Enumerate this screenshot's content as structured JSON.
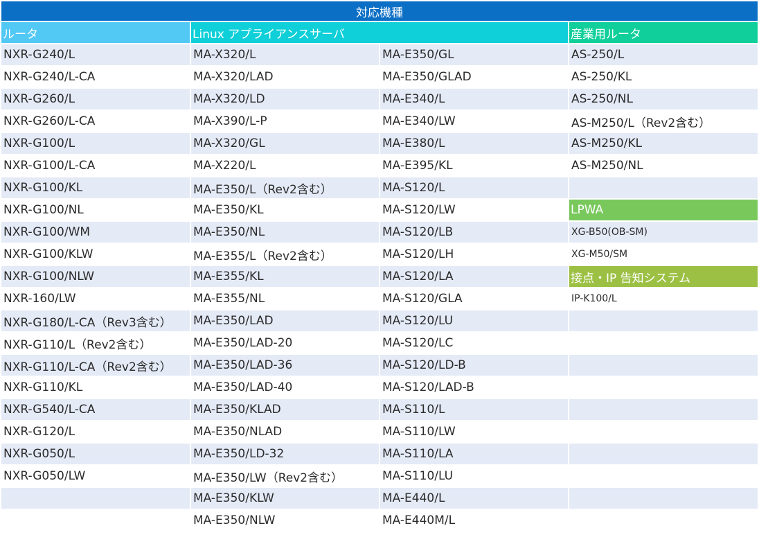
{
  "title": "対応機種",
  "headers": {
    "router": "ルータ",
    "linux": "Linux アプライアンスサーバ",
    "industrial": "産業用ルータ",
    "lpwa": "LPWA",
    "alarm": "接点・IP 告知システム"
  },
  "colors": {
    "title_bg": "#0c6fc6",
    "router_header": "#52c8f5",
    "linux_header": "#0fcfd8",
    "industrial_header": "#10cf9a",
    "lpwa_header": "#78c85c",
    "alarm_header": "#9cc043",
    "row_band": "#e4eaf6"
  },
  "router": [
    "NXR-G240/L",
    "NXR-G240/L-CA",
    "NXR-G260/L",
    "NXR-G260/L-CA",
    "NXR-G100/L",
    "NXR-G100/L-CA",
    "NXR-G100/KL",
    "NXR-G100/NL",
    "NXR-G100/WM",
    "NXR-G100/KLW",
    "NXR-G100/NLW",
    "NXR-160/LW",
    "NXR-G180/L-CA（Rev3含む）",
    "NXR-G110/L（Rev2含む）",
    "NXR-G110/L-CA（Rev2含む）",
    "NXR-G110/KL",
    "NXR-G540/L-CA",
    "NXR-G120/L",
    "NXR-G050/L",
    "NXR-G050/LW",
    "",
    ""
  ],
  "linux1": [
    "MA-X320/L",
    "MA-X320/LAD",
    "MA-X320/LD",
    "MA-X390/L-P",
    "MA-X320/GL",
    "MA-X220/L",
    "MA-E350/L（Rev2含む）",
    "MA-E350/KL",
    "MA-E350/NL",
    "MA-E355/L（Rev2含む）",
    "MA-E355/KL",
    "MA-E355/NL",
    "MA-E350/LAD",
    "MA-E350/LAD-20",
    "MA-E350/LAD-36",
    "MA-E350/LAD-40",
    "MA-E350/KLAD",
    "MA-E350/NLAD",
    "MA-E350/LD-32",
    "MA-E350/LW（Rev2含む）",
    "MA-E350/KLW",
    "MA-E350/NLW"
  ],
  "linux2": [
    "MA-E350/GL",
    "MA-E350/GLAD",
    "MA-E340/L",
    "MA-E340/LW",
    "MA-E380/L",
    "MA-E395/KL",
    "MA-S120/L",
    "MA-S120/LW",
    "MA-S120/LB",
    "MA-S120/LH",
    "MA-S120/LA",
    "MA-S120/GLA",
    "MA-S120/LU",
    "MA-S120/LC",
    "MA-S120/LD-B",
    "MA-S120/LAD-B",
    "MA-S110/L",
    "MA-S110/LW",
    "MA-S110/LA",
    "MA-S110/LU",
    "MA-E440/L",
    "MA-E440M/L"
  ],
  "industrial": [
    "AS-250/L",
    "AS-250/KL",
    "AS-250/NL",
    "AS-M250/L（Rev2含む）",
    "AS-M250/KL",
    "AS-M250/NL",
    ""
  ],
  "lpwa": [
    "XG-B50(OB-SM)",
    "XG-M50/SM"
  ],
  "alarm": [
    "IP-K100/L",
    "",
    "",
    "",
    "",
    "",
    "",
    "",
    "",
    ""
  ]
}
